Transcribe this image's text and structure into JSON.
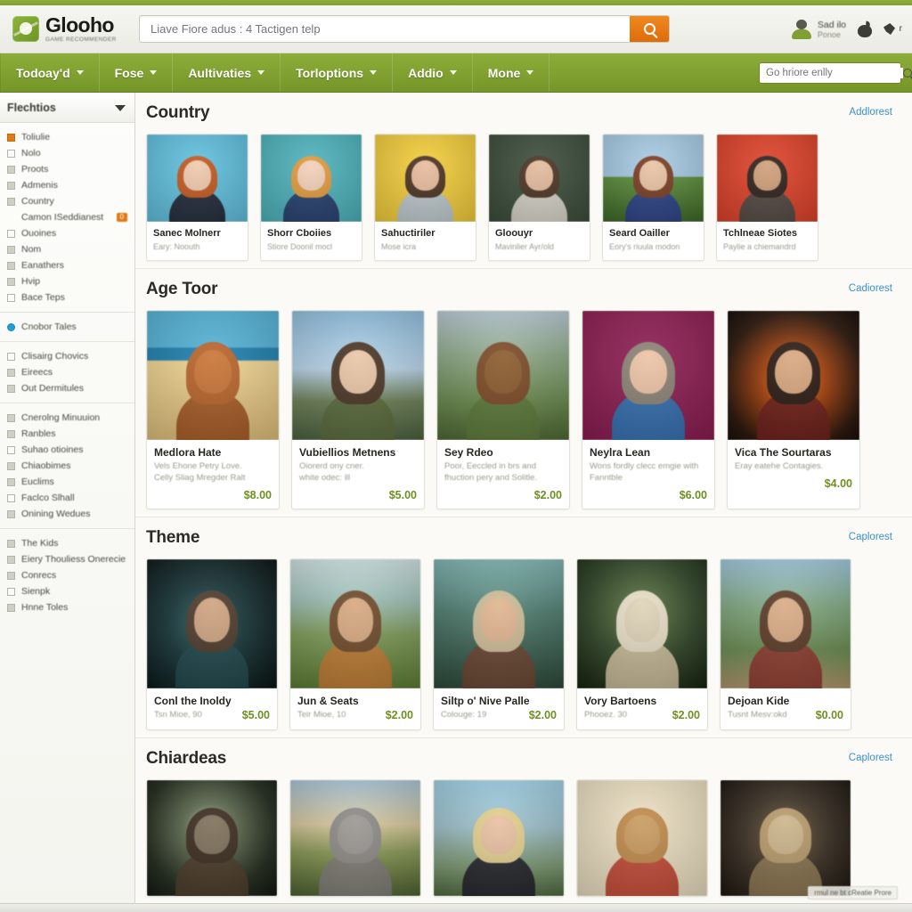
{
  "header": {
    "brand_name": "Glooho",
    "brand_tagline": "GAME RECOMMENDER",
    "search_placeholder": "Liave Fiore adus : 4 Tactigen telp",
    "search_button_icon": "search-icon",
    "account_name": "Sad ilo",
    "account_sub": "Ponoe",
    "icon_apple": "apple-icon",
    "icon_bird": "bird-icon",
    "icon_bird_label": "r"
  },
  "nav": {
    "items": [
      {
        "label": "Todoay'd"
      },
      {
        "label": "Fose"
      },
      {
        "label": "Aultivaties"
      },
      {
        "label": "Torloptions"
      },
      {
        "label": "Addio"
      },
      {
        "label": "Mone"
      }
    ],
    "search_placeholder": "Go hriore enlly"
  },
  "sidebar": {
    "title": "Flechtios",
    "groups": [
      {
        "items": [
          {
            "label": "Toliulie",
            "box": "orange"
          },
          {
            "label": "Nolo",
            "box": "empty"
          },
          {
            "label": "Proots",
            "box": "filled"
          },
          {
            "label": "Admenis",
            "box": "filled"
          },
          {
            "label": "Country",
            "box": "filled"
          },
          {
            "label": "Camon ISeddianest",
            "box": "none",
            "badge": "0"
          },
          {
            "label": "Ouoines",
            "box": "empty"
          },
          {
            "label": "Nom",
            "box": "filled"
          },
          {
            "label": "Eanathers",
            "box": "filled"
          },
          {
            "label": "Hvip",
            "box": "filled"
          },
          {
            "label": "Bace Teps",
            "box": "empty"
          }
        ]
      },
      {
        "items": [
          {
            "label": "Cnobor Tales",
            "box": "blue"
          }
        ]
      },
      {
        "items": [
          {
            "label": "Clisairg Chovics",
            "box": "empty"
          },
          {
            "label": "Eireecs",
            "box": "filled"
          },
          {
            "label": "Out Dermitules",
            "box": "filled"
          }
        ]
      },
      {
        "items": [
          {
            "label": "Cnerolng Minuuion",
            "box": "filled"
          },
          {
            "label": "Ranbles",
            "box": "filled"
          },
          {
            "label": "Suhao otioines",
            "box": "empty"
          },
          {
            "label": "Chiaobimes",
            "box": "filled"
          },
          {
            "label": "Euclims",
            "box": "filled"
          },
          {
            "label": "Faclco Slhall",
            "box": "empty"
          },
          {
            "label": "Onining Wedues",
            "box": "filled"
          }
        ]
      },
      {
        "items": [
          {
            "label": "The Kids",
            "box": "filled"
          },
          {
            "label": "Eiery Thouliess Onerecie",
            "box": "filled"
          },
          {
            "label": "Conrecs",
            "box": "filled"
          },
          {
            "label": "Sienpk",
            "box": "empty"
          },
          {
            "label": "Hnne Toles",
            "box": "filled"
          }
        ]
      }
    ]
  },
  "sections": [
    {
      "title": "Country",
      "link": "Addlorest",
      "cards": [
        {
          "title": "Sanec Molnerr",
          "sub": "Eary: Noouth",
          "price": "",
          "art": "portrait-redhead-blue"
        },
        {
          "title": "Shorr Cboiies",
          "sub": "Stiore Doonil mocl",
          "price": "",
          "art": "portrait-blonde-teal"
        },
        {
          "title": "Sahuctiriler",
          "sub": "Mose icra",
          "price": "",
          "art": "portrait-man-yellow"
        },
        {
          "title": "Gloouyr",
          "sub": "Mavinlier Ayr/old",
          "price": "",
          "art": "portrait-curly-green"
        },
        {
          "title": "Seard Oailler",
          "sub": "Eory's riuula modon",
          "price": "",
          "art": "scene-couple-field"
        },
        {
          "title": "Tchlneae Siotes",
          "sub": "Paylie a chiemandrd",
          "price": "",
          "art": "portrait-warrior-red"
        }
      ]
    },
    {
      "title": "Age Toor",
      "link": "Cadiorest",
      "cards": [
        {
          "title": "Medlora Hate",
          "sub": "Vels Ehone Petry Love.\nCelly Sliag Mregder Ralt",
          "price": "$8.00",
          "art": "dog-beach"
        },
        {
          "title": "Vubiellios Metnens",
          "sub": "Oiorerd ony cner.\nwhite odec: ill",
          "price": "$5.00",
          "art": "woman-green-cloak"
        },
        {
          "title": "Sey Rdeo",
          "sub": "Poor, Eeccled in brs and\nfhuction pery and Solitle.",
          "price": "$2.00",
          "art": "horse-forest"
        },
        {
          "title": "Neylra Lean",
          "sub": "Wons fordly clecc emgie with\nFanntble",
          "price": "$6.00",
          "art": "woman-magenta"
        },
        {
          "title": "Vica The Sourtaras",
          "sub": "Eray eatehe Contagies.",
          "price": "$4.00",
          "art": "cloaked-ember"
        }
      ]
    },
    {
      "title": "Theme",
      "link": "Caplorest",
      "cards": [
        {
          "title": "Conl the Inoldy",
          "sub": "Tsn Mioe, 90",
          "price": "$5.00",
          "art": "swimmer-cave"
        },
        {
          "title": "Jun & Seats",
          "sub": "Teir Mioe, 10",
          "price": "$2.00",
          "art": "rider-mountain"
        },
        {
          "title": "Siltp o' Nive Palle",
          "sub": "Colouge: 19",
          "price": "$2.00",
          "art": "bard-forest"
        },
        {
          "title": "Vory Bartoens",
          "sub": "Phooez. 30",
          "price": "$2.00",
          "art": "white-dog"
        },
        {
          "title": "Dejoan Kide",
          "sub": "Tusnt Mesv:okd",
          "price": "$0.00",
          "art": "family-path"
        }
      ]
    },
    {
      "title": "Chiardeas",
      "link": "Caplorest",
      "cards": [
        {
          "title": "",
          "sub": "",
          "price": "",
          "art": "moonlit-cabin"
        },
        {
          "title": "",
          "sub": "",
          "price": "",
          "art": "gray-beast-field"
        },
        {
          "title": "",
          "sub": "",
          "price": "",
          "art": "blonde-cliff"
        },
        {
          "title": "",
          "sub": "",
          "price": "",
          "art": "tapestry-creature"
        },
        {
          "title": "",
          "sub": "",
          "price": "",
          "art": "horned-goat"
        }
      ]
    }
  ],
  "toast": "rmul ne bt  cReatie Prore",
  "colors": {
    "nav_green": "#8dad39",
    "accent_orange": "#e07b14",
    "price_green": "#6f8f23",
    "link_blue": "#3a92c9"
  }
}
